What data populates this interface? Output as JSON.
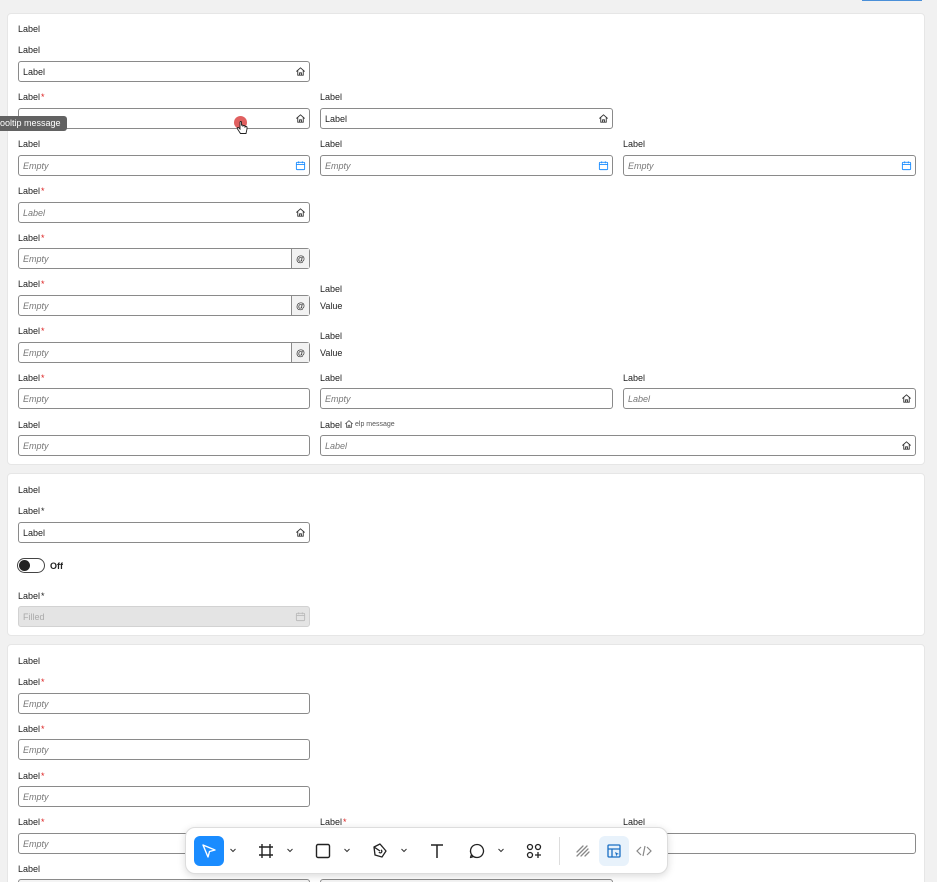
{
  "label": "Label",
  "required_mark": "*",
  "empty": "Empty",
  "value": "Value",
  "filled": "Filled",
  "off": "Off",
  "tooltip": "ooltip message",
  "help_message": "elp message",
  "at_sign": "@",
  "colors": {
    "accent": "#1a8cff",
    "required": "#dd2222",
    "tooltip_bg": "#626262",
    "cursor_dot": "#e06060"
  },
  "toolbar": {
    "tools": [
      "select-tool",
      "frame-tool",
      "shape-tool",
      "pen-tool",
      "text-tool",
      "comment-tool",
      "components-tool",
      "draw-mode",
      "design-mode",
      "dev-mode"
    ],
    "active": "select-tool"
  }
}
